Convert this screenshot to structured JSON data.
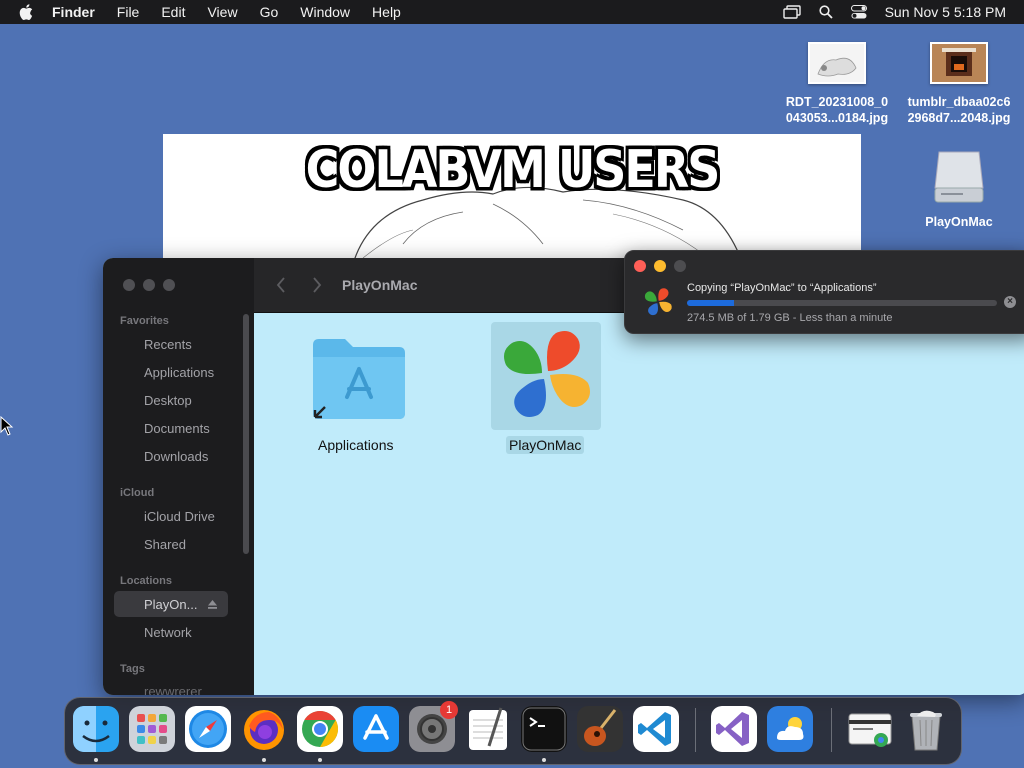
{
  "menubar": {
    "app_name": "Finder",
    "menus": [
      "File",
      "Edit",
      "View",
      "Go",
      "Window",
      "Help"
    ],
    "clock": "Sun Nov 5  5:18 PM"
  },
  "desktop": {
    "icons": [
      {
        "label_line1": "RDT_20231008_0",
        "label_line2": "043053...0184.jpg"
      },
      {
        "label_line1": "tumblr_dbaa02c6",
        "label_line2": "2968d7...2048.jpg"
      },
      {
        "label_line1": "PlayOnMac",
        "label_line2": ""
      }
    ]
  },
  "image_window": {
    "caption": "COLABVM USERS"
  },
  "finder": {
    "title": "PlayOnMac",
    "sidebar": {
      "favorites_header": "Favorites",
      "favorites": [
        "Recents",
        "Applications",
        "Desktop",
        "Documents",
        "Downloads"
      ],
      "icloud_header": "iCloud",
      "icloud": [
        "iCloud Drive",
        "Shared"
      ],
      "locations_header": "Locations",
      "locations": [
        "PlayOn...",
        "Network"
      ],
      "tags_header": "Tags",
      "tags": [
        "rewwrerer"
      ]
    },
    "items": [
      {
        "label": "Applications"
      },
      {
        "label": "PlayOnMac"
      }
    ]
  },
  "copy_dialog": {
    "message": "Copying “PlayOnMac” to “Applications”",
    "status": "274.5 MB of 1.79 GB - Less than a minute",
    "progress_fraction": 0.15
  },
  "dock": {
    "apps": [
      "Finder",
      "Launchpad",
      "Safari",
      "Firefox",
      "Chrome",
      "App Store",
      "System Settings",
      "TextEdit",
      "Terminal",
      "GarageBand",
      "Visual Studio Code",
      "Visual Studio",
      "Weather",
      "Chrome Apps Folder",
      "Trash"
    ],
    "settings_badge": "1"
  }
}
